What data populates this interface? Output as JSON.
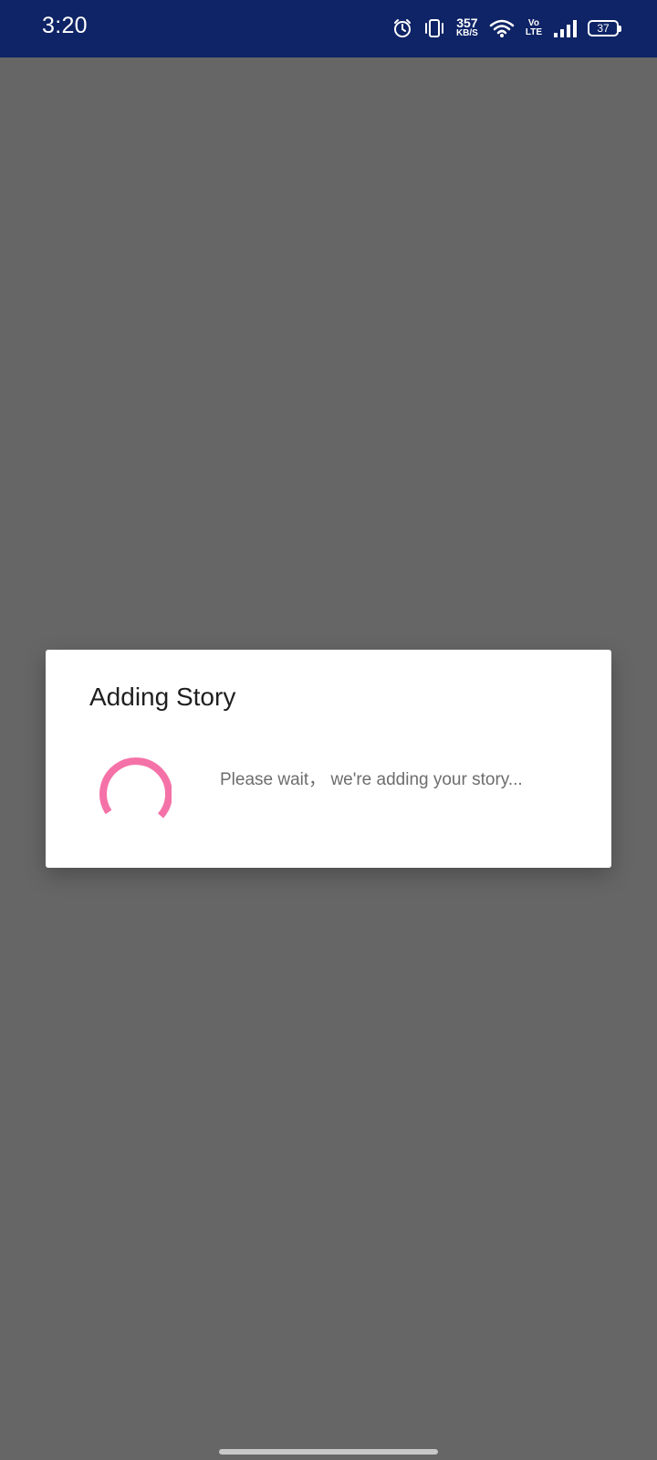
{
  "status_bar": {
    "time": "3:20",
    "net_speed_value": "357",
    "net_speed_unit": "KB/S",
    "volte_top": "Vo",
    "volte_bottom": "LTE",
    "battery_level": "37",
    "icons": [
      "alarm-icon",
      "vibrate-icon",
      "wifi-icon",
      "signal-icon",
      "battery-icon"
    ]
  },
  "dialog": {
    "title": "Adding Story",
    "message": "Please wait， we're adding your story...",
    "spinner_color": "#f472a8"
  },
  "colors": {
    "status_bar_bg": "#0f2466",
    "overlay_bg": "#666666",
    "dialog_bg": "#ffffff"
  }
}
